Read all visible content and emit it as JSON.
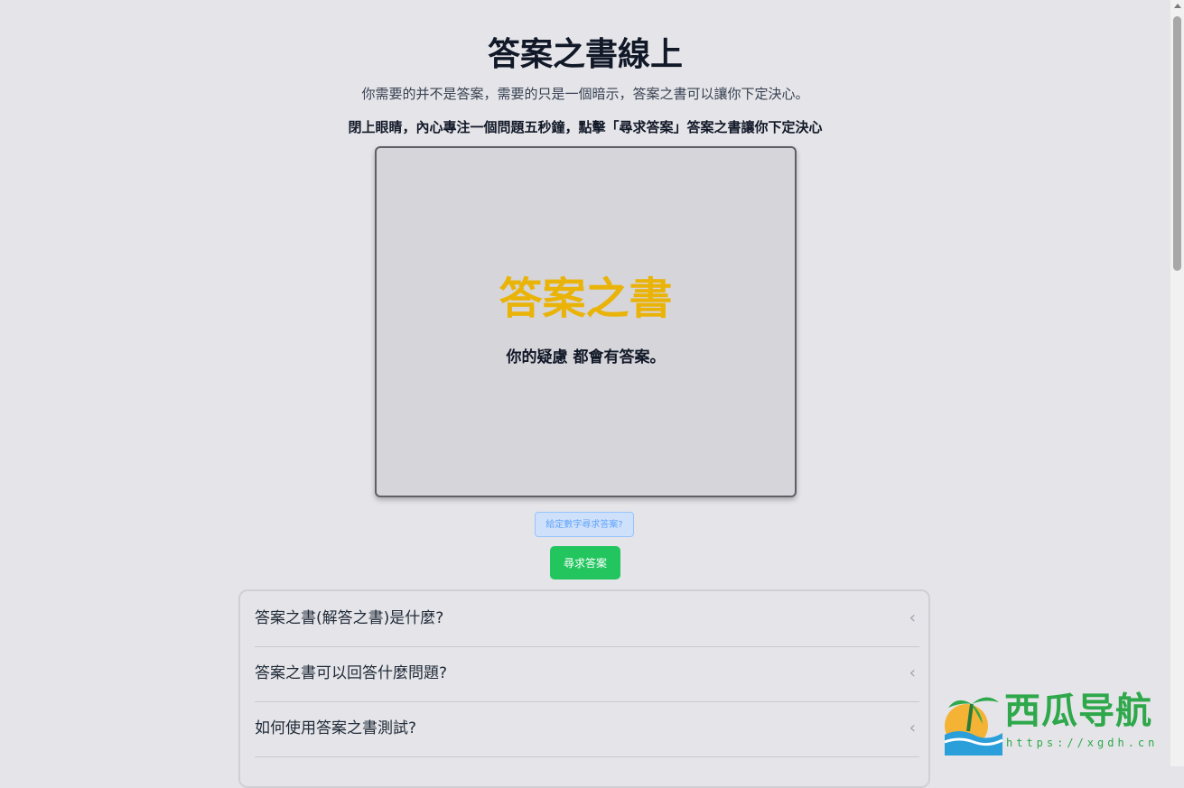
{
  "header": {
    "title": "答案之書線上",
    "subtitle": "你需要的并不是答案，需要的只是一個暗示，答案之書可以讓你下定決心。",
    "instruction": "閉上眼睛，內心專注一個問題五秒鐘，點擊「尋求答案」答案之書讓你下定決心"
  },
  "book": {
    "title": "答案之書",
    "tagline": "你的疑慮 都會有答案。"
  },
  "controls": {
    "number_placeholder": "給定數字尋求答案?",
    "seek_label": "尋求答案"
  },
  "faq": {
    "items": [
      {
        "question": "答案之書(解答之書)是什麼?"
      },
      {
        "question": "答案之書可以回答什麼問題?"
      },
      {
        "question": "如何使用答案之書測試?"
      }
    ],
    "chevron_icon": "chevron-left-icon"
  },
  "watermark": {
    "text": "西瓜导航",
    "url": "https://xgdh.cn"
  },
  "colors": {
    "background": "#e5e5e9",
    "book_title": "#eab308",
    "seek_button": "#22c55e",
    "watermark": "#2ea84a"
  }
}
